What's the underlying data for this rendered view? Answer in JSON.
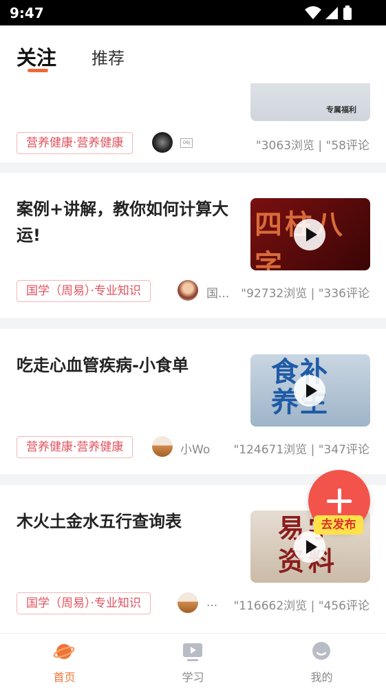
{
  "status_bar": {
    "time": "9:47"
  },
  "header": {
    "tabs": [
      {
        "label": "关注",
        "active": true
      },
      {
        "label": "推荐",
        "active": false
      }
    ]
  },
  "cards": [
    {
      "title": "",
      "tag": "营养健康·营养健康",
      "author": "",
      "stats": "\"3063浏览 | \"58评论",
      "thumb_text": "专属福利"
    },
    {
      "title": "案例+讲解，教你如何计算大运!",
      "tag": "国学（周易）·专业知识",
      "author": "国...",
      "stats": "\"92732浏览 | \"336评论",
      "thumb_text": "四柱八字"
    },
    {
      "title": "吃走心血管疾病-小食单",
      "tag": "营养健康·营养健康",
      "author": "小Wo",
      "stats": "\"124671浏览 | \"347评论",
      "thumb_text": "食补养生"
    },
    {
      "title": "木火土金水五行查询表",
      "tag": "国学（周易）·专业知识",
      "author": "...",
      "stats": "\"116662浏览 | \"456评论",
      "thumb_text": "易学资料"
    }
  ],
  "fab": {
    "label": "去发布"
  },
  "bottom_nav": [
    {
      "label": "首页",
      "icon": "planet-icon",
      "active": true
    },
    {
      "label": "学习",
      "icon": "video-icon",
      "active": false
    },
    {
      "label": "我的",
      "icon": "user-icon",
      "active": false
    }
  ],
  "colors": {
    "accent": "#f07436",
    "tag_red": "#e0525e",
    "fab": "#f2544c",
    "fab_label_bg": "#ffe24a"
  }
}
